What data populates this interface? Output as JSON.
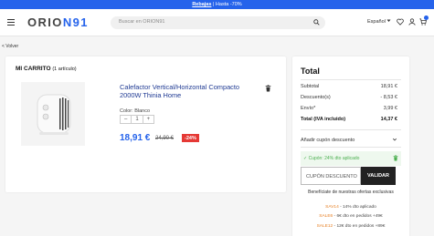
{
  "promo": {
    "link": "Rebajas",
    "text": " | Hasta -70%"
  },
  "header": {
    "logo_main": "ORIO",
    "logo_n": "N",
    "logo_num": "91",
    "search_placeholder": "Buscar en ORION91",
    "language": "Español",
    "icons": [
      "menu-icon",
      "search-icon",
      "chevron-down-icon",
      "heart-icon",
      "user-icon",
      "cart-icon"
    ]
  },
  "back_label": "< Volver",
  "cart": {
    "title": "MI CARRITO",
    "count": "(1 artículo)",
    "product": {
      "name": "Calefactor Vertical/Horizontal Compacto 2000W Thinia Home",
      "color": "Color: Blanco",
      "qty_minus": "–",
      "qty": "1",
      "qty_plus": "+",
      "price": "18,91 €",
      "old_price": "24,90 €",
      "discount": "-24%"
    }
  },
  "summary": {
    "title": "Total",
    "rows": [
      {
        "label": "Subtotal",
        "value": "18,91 €"
      },
      {
        "label": "Descuento(s)",
        "value": "- 8,53 €"
      },
      {
        "label": "Envío*",
        "value": "3,99 €"
      },
      {
        "label": "Total (IVA incluido)",
        "value": "14,37 €"
      }
    ],
    "add_coupon": "Añadir cupón descuento",
    "applied_coupon": "✓ Cupón: 24% dto aplicado",
    "coupon_placeholder": "CUPÓN DESCUENTO",
    "validate_label": "VALIDAR",
    "offers_title": "Benefíciate de nuestras ofertas exclusivas",
    "coupons": [
      {
        "code": "SAV14",
        "text": " - 14% dto aplicado"
      },
      {
        "code": "SALE6",
        "text": " - 6€ dto en pedidos +49€"
      },
      {
        "code": "SALE12",
        "text": " - 12€ dto en pedidos +89€"
      }
    ]
  },
  "colors": {
    "accent": "#2563eb",
    "discount": "#e53935",
    "applied": "#4caf50",
    "code": "#e67e22"
  }
}
